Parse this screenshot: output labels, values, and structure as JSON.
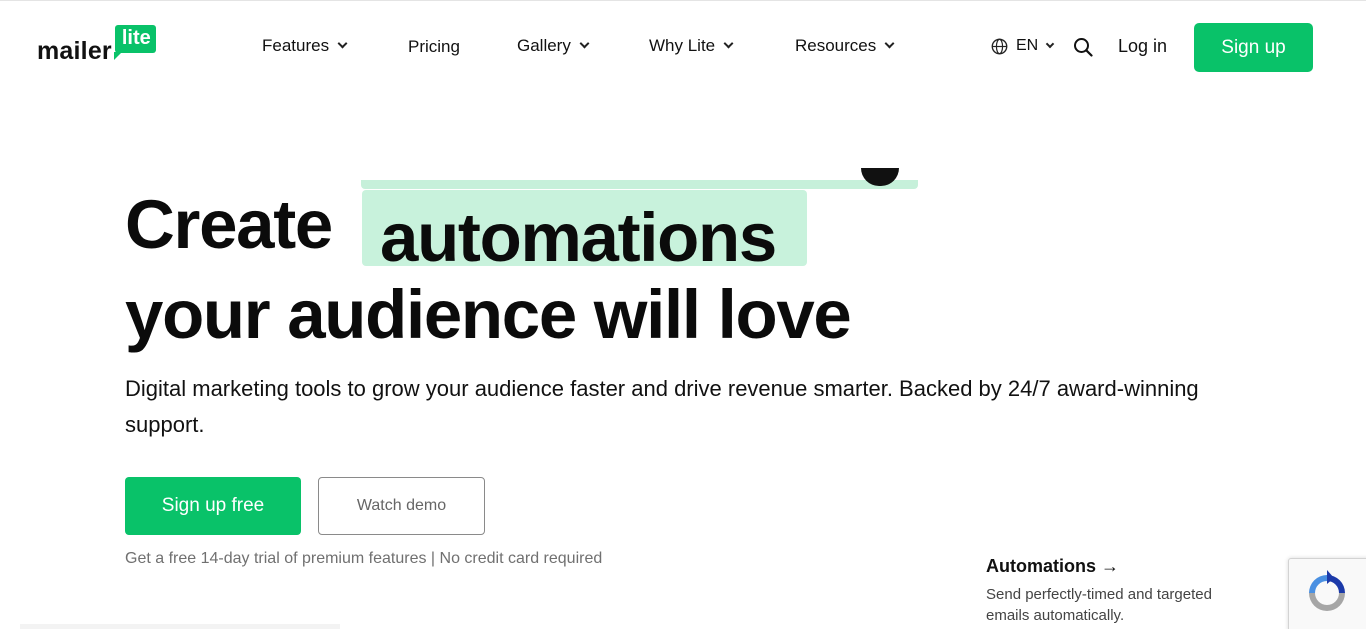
{
  "brand": {
    "word": "mailer",
    "badge": "lite",
    "accent_color": "#09c269"
  },
  "nav": {
    "items": [
      {
        "label": "Features",
        "has_dropdown": true
      },
      {
        "label": "Pricing",
        "has_dropdown": false
      },
      {
        "label": "Gallery",
        "has_dropdown": true
      },
      {
        "label": "Why Lite",
        "has_dropdown": true
      },
      {
        "label": "Resources",
        "has_dropdown": true
      }
    ],
    "language": "EN",
    "login_label": "Log in",
    "signup_label": "Sign up",
    "icons": {
      "language": "globe-icon",
      "search": "search-icon",
      "dropdown": "chevron-down-icon"
    }
  },
  "hero": {
    "headline_start": "Create",
    "headline_highlight": "automations",
    "headline_end": "your audience will love",
    "highlight_color": "#c8f2dc",
    "subtitle": "Digital marketing tools to grow your audience faster and drive revenue smarter. Backed by 24/7 award-winning support.",
    "cta_primary": "Sign up free",
    "cta_secondary": "Watch demo",
    "trial_note": "Get a free 14-day trial of premium features | No credit card required"
  },
  "feature_card": {
    "title": "Automations →",
    "description": "Send perfectly-timed and targeted emails automatically."
  },
  "recaptcha": {
    "icon": "recaptcha-icon"
  }
}
